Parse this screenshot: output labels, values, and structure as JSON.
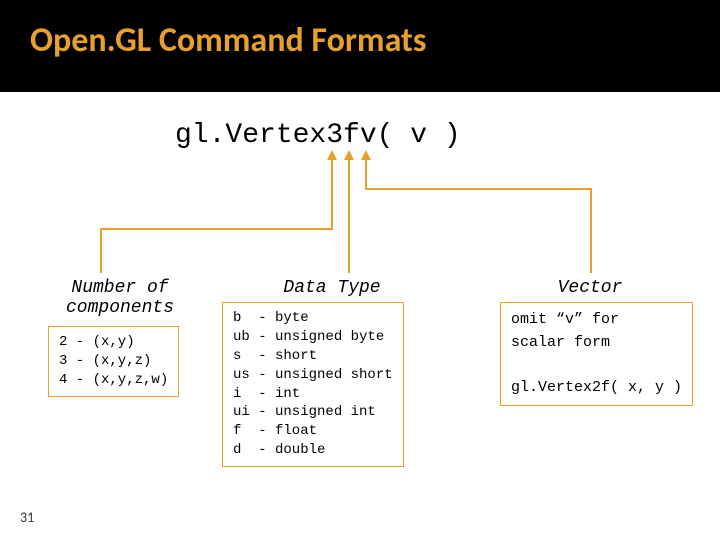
{
  "header": {
    "title": "Open.GL Command Formats"
  },
  "command": {
    "prefix": "gl.Vertex",
    "num": "3",
    "type": "f",
    "vec": "v",
    "open": "(",
    "arg": " v ",
    "close": ")"
  },
  "left": {
    "title": "Number of\ncomponents",
    "body": "2 - (x,y)\n3 - (x,y,z)\n4 - (x,y,z,w)"
  },
  "mid": {
    "title": "Data Type",
    "body": "b  - byte\nub - unsigned byte\ns  - short\nus - unsigned short\ni  - int\nui - unsigned int\nf  - float\nd  - double"
  },
  "right": {
    "title": "Vector",
    "body": "omit “v” for\nscalar form\n\ngl.Vertex2f( x, y )"
  },
  "footer": {
    "page": "31"
  }
}
